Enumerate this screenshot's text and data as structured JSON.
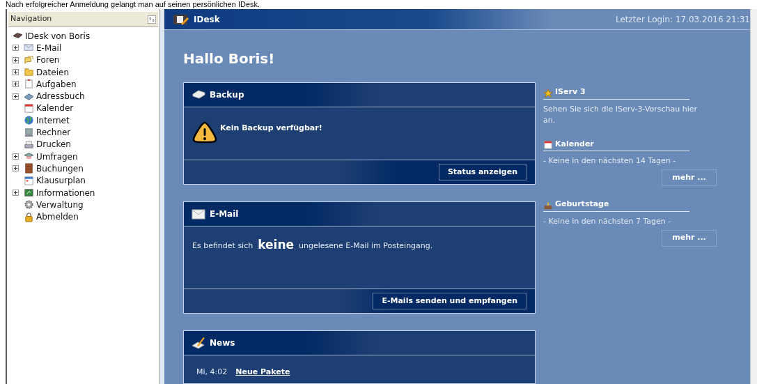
{
  "caption": "Nach erfolgreicher Anmeldung gelangt man auf seinen persönlichen IDesk.",
  "sidebar": {
    "title": "Navigation",
    "root": "IDesk von Boris",
    "items": [
      {
        "label": "E-Mail",
        "kind": "group"
      },
      {
        "label": "Foren",
        "kind": "group"
      },
      {
        "label": "Dateien",
        "kind": "group"
      },
      {
        "label": "Aufgaben",
        "kind": "group"
      },
      {
        "label": "Adressbuch",
        "kind": "group"
      },
      {
        "label": "Kalender",
        "kind": "link"
      },
      {
        "label": "Internet",
        "kind": "link"
      },
      {
        "label": "Rechner",
        "kind": "link"
      },
      {
        "label": "Drucken",
        "kind": "link"
      },
      {
        "label": "Umfragen",
        "kind": "group"
      },
      {
        "label": "Buchungen",
        "kind": "group"
      },
      {
        "label": "Klausurplan",
        "kind": "link"
      },
      {
        "label": "Informationen",
        "kind": "group"
      },
      {
        "label": "Verwaltung",
        "kind": "link"
      },
      {
        "label": "Abmelden",
        "kind": "link"
      }
    ]
  },
  "header": {
    "title": "IDesk",
    "last_login": "Letzter Login: 17.03.2016 21:31"
  },
  "greeting": "Hallo Boris!",
  "cards": [
    {
      "title": "Backup",
      "kind": "warning",
      "message": "Kein Backup verfügbar!",
      "button": "Status anzeigen"
    },
    {
      "title": "E-Mail",
      "kind": "text",
      "message": "Es befindet sich  **keine**  ungelesene E-Mail im Posteingang.",
      "button": "E-Mails senden und empfangen"
    },
    {
      "title": "News",
      "kind": "news",
      "time": "Mi, 4:02",
      "link": "Neue Pakete"
    }
  ],
  "side_boxes": [
    {
      "title": "IServ 3",
      "text": "Sehen Sie sich die IServ-3-Vorschau hier an."
    },
    {
      "title": "Kalender",
      "text": "- Keine in den nächsten 14 Tagen -",
      "button": "mehr ..."
    },
    {
      "title": "Geburtstage",
      "text": "- Keine in den nächsten 7 Tagen -",
      "button": "mehr ..."
    }
  ]
}
